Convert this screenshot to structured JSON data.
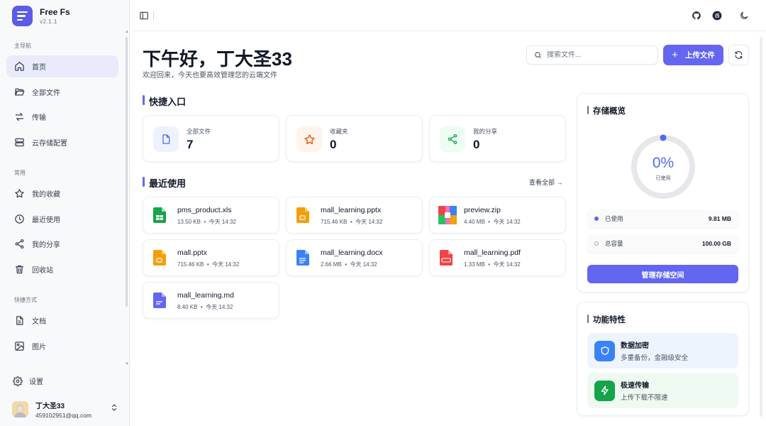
{
  "brand": {
    "name": "Free Fs",
    "version": "v2.1.1"
  },
  "sidebar": {
    "sections": [
      "主导航",
      "常用",
      "快捷方式"
    ],
    "main_items": [
      {
        "label": "首页",
        "icon": "home-icon",
        "active": true
      },
      {
        "label": "全部文件",
        "icon": "folder-open-icon"
      },
      {
        "label": "传输",
        "icon": "transfer-icon"
      },
      {
        "label": "云存储配置",
        "icon": "server-icon"
      }
    ],
    "common_items": [
      {
        "label": "我的收藏",
        "icon": "star-icon"
      },
      {
        "label": "最近使用",
        "icon": "clock-icon"
      },
      {
        "label": "我的分享",
        "icon": "share-icon"
      },
      {
        "label": "回收站",
        "icon": "trash-icon"
      }
    ],
    "shortcut_items": [
      {
        "label": "文档",
        "icon": "document-icon"
      },
      {
        "label": "图片",
        "icon": "image-icon"
      }
    ],
    "settings_label": "设置"
  },
  "user": {
    "name": "丁大圣33",
    "email": "459102951@qq.com"
  },
  "header": {
    "greeting": "下午好，丁大圣33",
    "subtitle": "欢迎回来，今天也要高效管理您的云端文件",
    "search_placeholder": "搜索文件...",
    "upload_label": "上传文件"
  },
  "quick": {
    "title": "快捷入口",
    "cards": [
      {
        "label": "全部文件",
        "count": "7"
      },
      {
        "label": "收藏夹",
        "count": "0"
      },
      {
        "label": "我的分享",
        "count": "0"
      }
    ]
  },
  "recent": {
    "title": "最近使用",
    "view_all": "查看全部 →",
    "files": [
      {
        "name": "pms_product.xls",
        "size": "13.50 KB",
        "time": "今天 14:32",
        "type": "xls"
      },
      {
        "name": "mall_learning.pptx",
        "size": "715.46 KB",
        "time": "今天 14:32",
        "type": "ppt"
      },
      {
        "name": "preview.zip",
        "size": "4.40 MB",
        "time": "今天 14:32",
        "type": "zip"
      },
      {
        "name": "mall.pptx",
        "size": "715.46 KB",
        "time": "今天 14:32",
        "type": "ppt"
      },
      {
        "name": "mall_learning.docx",
        "size": "2.66 MB",
        "time": "今天 14:32",
        "type": "doc"
      },
      {
        "name": "mall_learning.pdf",
        "size": "1.33 MB",
        "time": "今天 14:32",
        "type": "pdf"
      },
      {
        "name": "mall_learning.md",
        "size": "8.40 KB",
        "time": "今天 14:32",
        "type": "md"
      }
    ],
    "separator": "•"
  },
  "storage": {
    "title": "存储概览",
    "percent": "0%",
    "percent_label": "已使用",
    "used_fraction": 0,
    "used_label": "已使用",
    "used_value": "9.81 MB",
    "total_label": "总容量",
    "total_value": "100.00 GB",
    "manage_label": "管理存储空间"
  },
  "features": {
    "title": "功能特性",
    "items": [
      {
        "title": "数据加密",
        "desc": "多重备份，金融级安全"
      },
      {
        "title": "极速传输",
        "desc": "上传下载不限速"
      }
    ]
  },
  "colors": {
    "accent": "#6366f1",
    "ring": "#4f6bed",
    "success": "#16a34a",
    "primary_blue": "#3b82f6"
  }
}
